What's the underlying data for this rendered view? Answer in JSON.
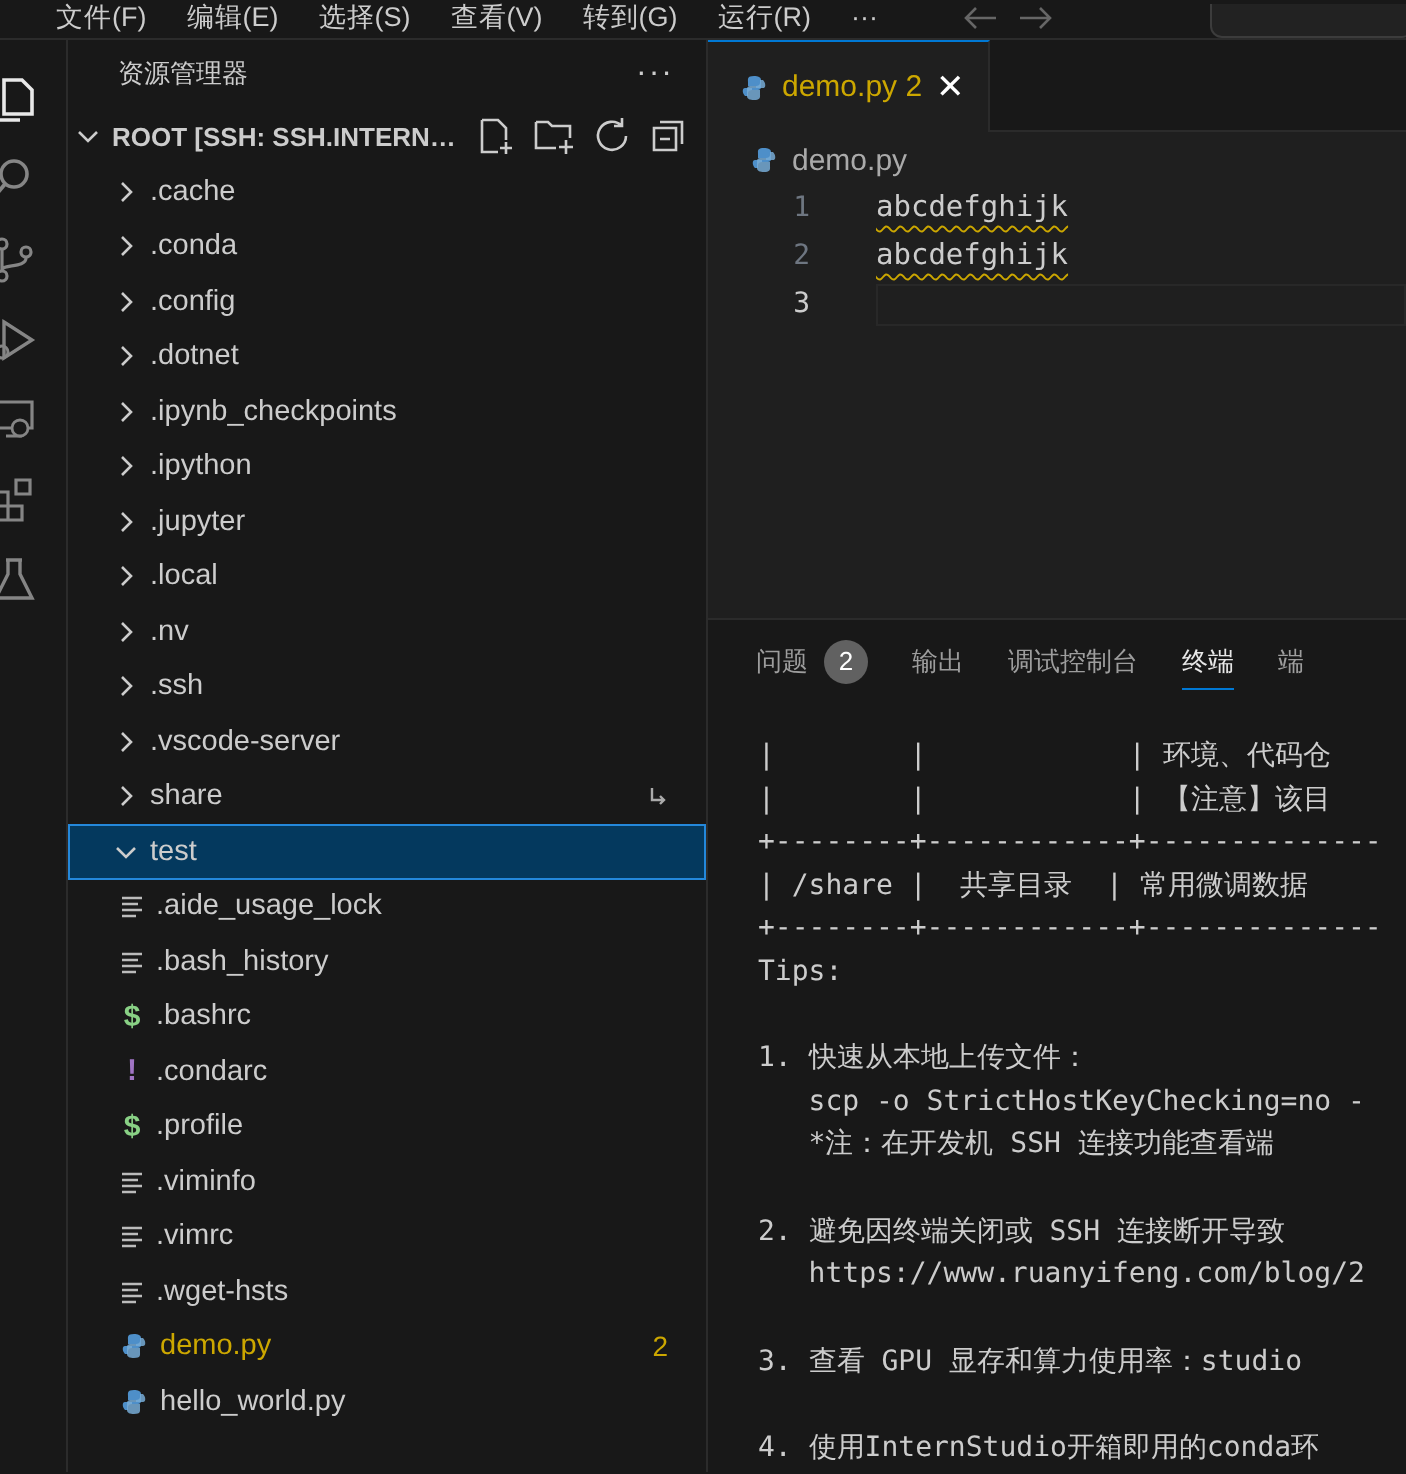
{
  "menu_bar": {
    "items": [
      "文件(F)",
      "编辑(E)",
      "选择(S)",
      "查看(V)",
      "转到(G)",
      "运行(R)",
      "···"
    ]
  },
  "activity_bar": {
    "items": [
      {
        "kind": "explorer",
        "selected": true
      },
      {
        "kind": "search",
        "selected": false
      },
      {
        "kind": "source-control",
        "selected": false
      },
      {
        "kind": "run",
        "selected": false
      },
      {
        "kind": "remote",
        "selected": false
      },
      {
        "kind": "extensions",
        "selected": false
      },
      {
        "kind": "testing",
        "selected": false
      }
    ]
  },
  "explorer": {
    "title": "资源管理器",
    "more": "···",
    "root": {
      "label": "ROOT [SSH: SSH.INTERN…",
      "expanded": true
    },
    "tree": [
      {
        "label": ".cache",
        "kind": "folder",
        "expanded": false,
        "selected": false
      },
      {
        "label": ".conda",
        "kind": "folder",
        "expanded": false,
        "selected": false
      },
      {
        "label": ".config",
        "kind": "folder",
        "expanded": false,
        "selected": false
      },
      {
        "label": ".dotnet",
        "kind": "folder",
        "expanded": false,
        "selected": false
      },
      {
        "label": ".ipynb_checkpoints",
        "kind": "folder",
        "expanded": false,
        "selected": false
      },
      {
        "label": ".ipython",
        "kind": "folder",
        "expanded": false,
        "selected": false
      },
      {
        "label": ".jupyter",
        "kind": "folder",
        "expanded": false,
        "selected": false
      },
      {
        "label": ".local",
        "kind": "folder",
        "expanded": false,
        "selected": false
      },
      {
        "label": ".nv",
        "kind": "folder",
        "expanded": false,
        "selected": false
      },
      {
        "label": ".ssh",
        "kind": "folder",
        "expanded": false,
        "selected": false
      },
      {
        "label": ".vscode-server",
        "kind": "folder",
        "expanded": false,
        "selected": false
      },
      {
        "label": "share",
        "kind": "folder",
        "expanded": false,
        "selected": false,
        "symlink": true
      },
      {
        "label": "test",
        "kind": "folder",
        "expanded": true,
        "selected": true,
        "children": [
          {
            "label": ".aide_usage_lock",
            "kind": "text",
            "selected": false
          },
          {
            "label": ".bash_history",
            "kind": "text",
            "selected": false
          },
          {
            "label": ".bashrc",
            "kind": "shell",
            "icon": "$",
            "selected": false
          },
          {
            "label": ".condarc",
            "kind": "yaml",
            "icon": "!",
            "selected": false
          },
          {
            "label": ".profile",
            "kind": "shell",
            "icon": "$",
            "selected": false
          },
          {
            "label": ".viminfo",
            "kind": "text",
            "selected": false
          },
          {
            "label": ".vimrc",
            "kind": "text",
            "selected": false
          },
          {
            "label": ".wget-hsts",
            "kind": "text",
            "selected": false
          },
          {
            "label": "demo.py",
            "kind": "python",
            "selected": false,
            "warning": true,
            "badge": "2"
          },
          {
            "label": "hello_world.py",
            "kind": "python",
            "selected": false,
            "warning": false
          }
        ]
      }
    ]
  },
  "editor": {
    "tabs": [
      {
        "label": "demo.py",
        "badge": "2",
        "selected": true,
        "warning": true,
        "close": "✕"
      }
    ],
    "breadcrumb": "demo.py",
    "lines": [
      {
        "number": "1",
        "text": "abcdefghijk",
        "warning": true,
        "current": false
      },
      {
        "number": "2",
        "text": "abcdefghijk",
        "warning": true,
        "current": false
      },
      {
        "number": "3",
        "current": true
      }
    ]
  },
  "panel": {
    "tabs": [
      {
        "label": "问题",
        "badge": "2",
        "selected": false
      },
      {
        "label": "输出",
        "selected": false
      },
      {
        "label": "调试控制台",
        "selected": false
      },
      {
        "label": "终端",
        "selected": true
      },
      {
        "label": "端",
        "selected": false
      }
    ],
    "terminal": {
      "blocks": [
        [
          "|        |            | 环境、代码仓",
          "|        |            | 【注意】该目",
          "+--------+------------+--------------",
          "| /share |  共享目录  | 常用微调数据",
          "+--------+------------+--------------",
          "Tips:"
        ],
        [
          "1. 快速从本地上传文件：",
          "   scp -o StrictHostKeyChecking=no -",
          "   *注：在开发机 SSH 连接功能查看端"
        ],
        [
          "2. 避免因终端关闭或 SSH 连接断开导致",
          "   https://www.ruanyifeng.com/blog/2"
        ],
        [
          "3. 查看 GPU 显存和算力使用率：studio"
        ],
        [
          "4. 使用InternStudio开箱即用的conda环"
        ]
      ]
    }
  }
}
